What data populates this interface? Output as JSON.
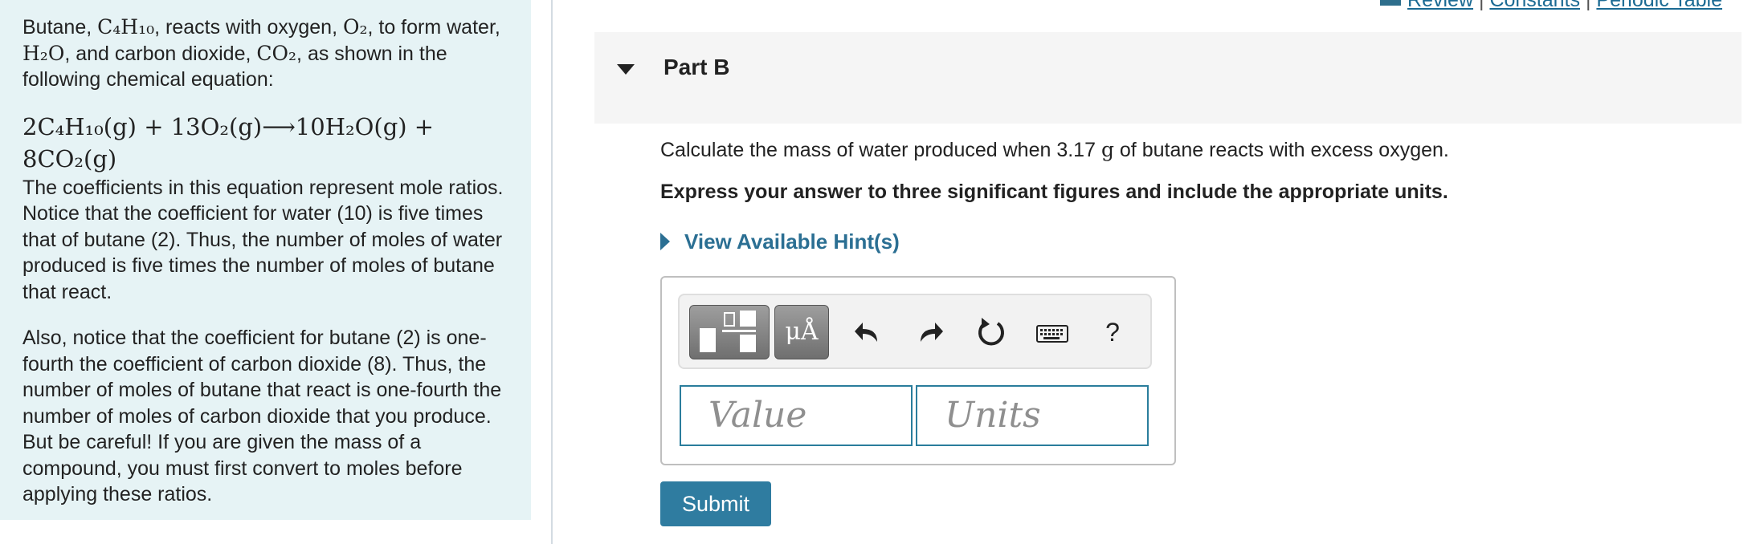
{
  "intro": {
    "p1_a": "Butane, ",
    "p1_butane": "C₄H₁₀",
    "p1_b": ", reacts with oxygen, ",
    "p1_oxygen": "O₂",
    "p1_c": ", to form water, ",
    "p1_water": "H₂O",
    "p1_d": ", and carbon dioxide, ",
    "p1_co2": "CO₂",
    "p1_e": ", as shown in the following chemical equation:",
    "equation": "2C₄H₁₀(g) + 13O₂(g)⟶10H₂O(g) + 8CO₂(g)",
    "p2": "The coefficients in this equation represent mole ratios. Notice that the coefficient for water (10) is five times that of butane (2). Thus, the number of moles of water produced is five times the number of moles of butane that react.",
    "p3": "Also, notice that the coefficient for butane (2) is one-fourth the coefficient of carbon dioxide (8). Thus, the number of moles of butane that react is one-fourth the number of moles of carbon dioxide that you produce.",
    "p4": "But be careful! If you are given the mass of a compound, you must first convert to moles before applying these ratios."
  },
  "top_links": {
    "review": "Review",
    "sep1": "|",
    "constants": "Constants",
    "sep2": "|",
    "periodic": "Periodic Table"
  },
  "part": {
    "title": "Part B"
  },
  "question": {
    "pre": "Calculate the mass of water produced when 3.17 ",
    "unit": "g",
    "post": " of butane reacts with excess oxygen."
  },
  "instruction": "Express your answer to three significant figures and include the appropriate units.",
  "hint_label": "View Available Hint(s)",
  "toolbar": {
    "units_button": "μÅ",
    "help": "?"
  },
  "inputs": {
    "value_placeholder": "Value",
    "units_placeholder": "Units"
  },
  "submit_label": "Submit",
  "colors": {
    "panel_bg": "#e6f3f5",
    "accent": "#2f7ca0",
    "link": "#1b6a93",
    "field_border": "#2a7d9c"
  }
}
